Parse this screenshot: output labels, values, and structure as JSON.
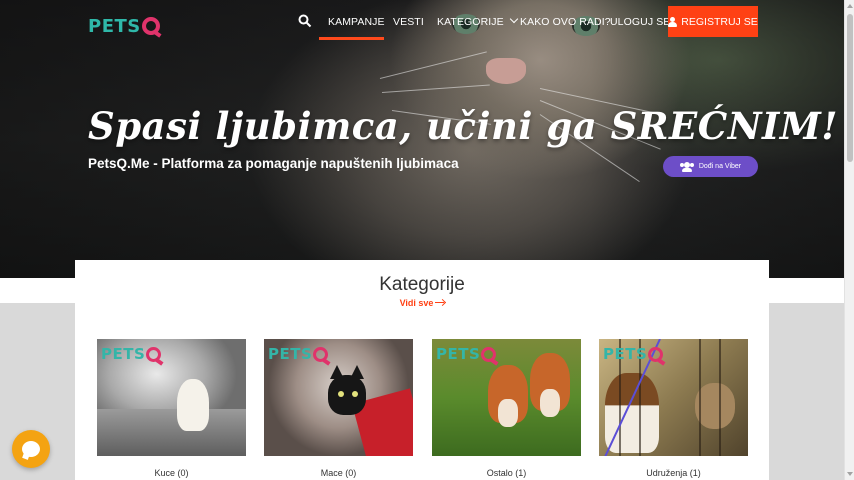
{
  "brand": {
    "logo_text": "PETS",
    "accent": "#ff4114",
    "teal": "#2fb8a9",
    "pink": "#e0336b"
  },
  "nav": {
    "search_icon": "search-icon",
    "items": [
      {
        "label": "KAMPANJE",
        "active": true
      },
      {
        "label": "VESTI",
        "active": false
      },
      {
        "label": "KATEGORIJE",
        "active": false
      },
      {
        "label": "KAKO OVO RADI?",
        "active": false
      },
      {
        "label": "ULOGUJ SE",
        "active": false
      }
    ],
    "register_label": "REGISTRUJ SE"
  },
  "hero": {
    "title": "Spasi ljubimca, učini ga SREĆNIM!",
    "subtitle": "PetsQ.Me - Platforma za pomaganje napuštenih ljubimaca",
    "viber_label": "Dođi na Viber"
  },
  "categories_section": {
    "title": "Kategorije",
    "see_all": "Vidi sve",
    "items": [
      {
        "label": "Kuce (0)",
        "card_logo": "PETS"
      },
      {
        "label": "Mace (0)",
        "card_logo": "PETS"
      },
      {
        "label": "Ostalo (1)",
        "card_logo": "PETS"
      },
      {
        "label": "Udruženja (1)",
        "card_logo": "PETS"
      }
    ]
  },
  "chat": {
    "icon": "chat-bubble-icon"
  }
}
